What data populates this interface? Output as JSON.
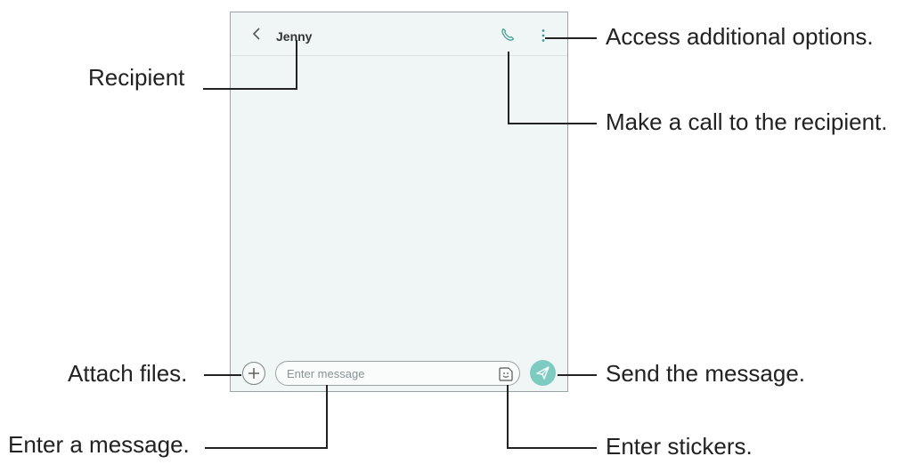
{
  "screen": {
    "header": {
      "back_icon": "chevron-left-icon",
      "recipient_name": "Jenny",
      "call_icon": "phone-icon",
      "more_icon": "vertical-dots-icon"
    },
    "compose": {
      "attach_icon": "plus-icon",
      "input_placeholder": "Enter message",
      "sticker_icon": "sticker-icon",
      "send_icon": "send-icon",
      "send_color": "#7ecbc2"
    }
  },
  "annotations": {
    "recipient": "Recipient",
    "more_options": "Access additional options.",
    "call": "Make a call to the recipient.",
    "attach": "Attach files.",
    "send": "Send the message.",
    "enter_message": "Enter a message.",
    "stickers": "Enter stickers."
  }
}
